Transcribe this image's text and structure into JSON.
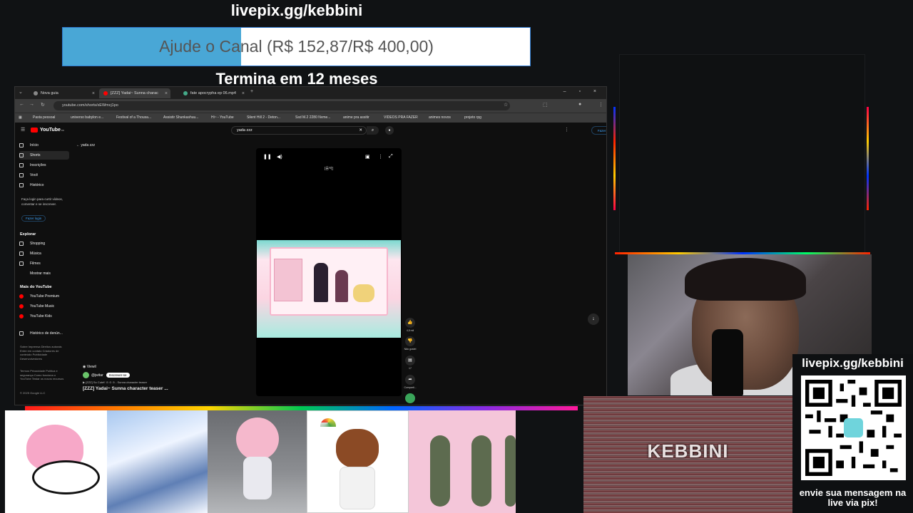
{
  "overlay": {
    "top_url": "livepix.gg/kebbini",
    "goal_text": "Ajude o Canal (R$ 152,87/R$ 400,00)",
    "goal_progress": 0.382,
    "goal_end": "Termina em 12 meses",
    "qr_url": "livepix.gg/kebbini",
    "qr_message": "envie sua mensagem na live via pix!",
    "cam_label": "KEBBINI"
  },
  "browser": {
    "tabs": [
      {
        "label": "Nova guia",
        "active": false
      },
      {
        "label": "[ZZZ] Yadai~ Sunna charac",
        "active": true
      },
      {
        "label": "fate apocrypha ep 06.mp4",
        "active": false
      }
    ],
    "new_tab": "+",
    "url": "youtube.com/shorts/xEWmcj1po",
    "bookmarks": [
      "Pasta pessoal",
      "universo babylon e...",
      "Festival of a Thousa...",
      "Assistir Shunkashuu...",
      "Hi~ - YouTube",
      "Silent Hill 2 - Deton...",
      "Ssd M.2 2280 Nvme...",
      "anime pra assitir",
      "VIDEOS PRA FAZER",
      "animes novos",
      "projeto rpg"
    ]
  },
  "youtube": {
    "logo": "YouTube",
    "logo_sup": "BR",
    "search_value": "yada zzz",
    "search_clear": "✕",
    "login_label": "Fazer login",
    "back_label": "yada zzz",
    "sidebar": [
      {
        "label": "Início"
      },
      {
        "label": "Shorts"
      },
      {
        "label": "Inscrições"
      },
      {
        "label": "Você"
      },
      {
        "label": "Histórico"
      }
    ],
    "signin_note": "Faça login para curtir vídeos, comentar e se inscrever.",
    "signin_button": "Fazer login",
    "explore_heading": "Explorar",
    "explore": [
      {
        "label": "Shopping"
      },
      {
        "label": "Música"
      },
      {
        "label": "Filmes"
      },
      {
        "label": "Mostrar mais"
      }
    ],
    "more_heading": "Mais do YouTube",
    "more": [
      {
        "label": "YouTube Premium"
      },
      {
        "label": "YouTube Music"
      },
      {
        "label": "YouTube Kids"
      }
    ],
    "report_history": "Histórico de denún...",
    "footer1": "Sobre Imprensa Direitos autorais Entre em contato Criadores de conteúdo Publicidade Desenvolvedores",
    "footer2": "Termos Privacidade Política e segurança Como funciona o YouTube Testar os novos recursos",
    "copyright": "© 2025 Google LLC",
    "player_caption": "[음악]",
    "likes": "4,5 mil",
    "dislike_label": "Não gostei",
    "comments": "17",
    "share_label": "Comparti...",
    "location": "Viewil",
    "channel": "@jwitar",
    "subscribe": "Inscrever-se",
    "sound_line": "[ZZZ] So Cute!! ⊙ ⊙ ⊙ - Sunna character teaser",
    "title": "[ZZZ] Yadai~ Sunna character teaser ..."
  }
}
